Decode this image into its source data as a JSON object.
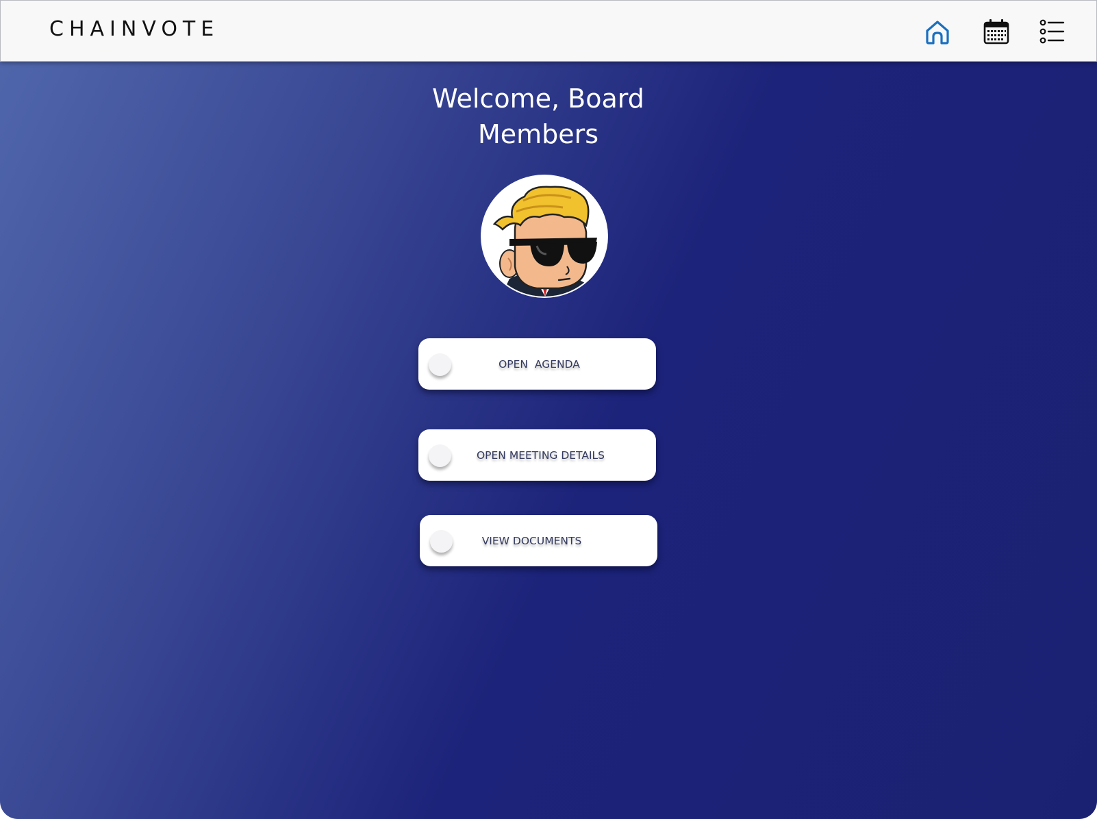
{
  "header": {
    "brand": "CHAINVOTE",
    "nav": [
      {
        "icon": "home-icon",
        "active": true,
        "color": "#1a6fc0"
      },
      {
        "icon": "calendar-icon",
        "active": false,
        "color": "#111111"
      },
      {
        "icon": "list-icon",
        "active": false,
        "color": "#111111"
      }
    ]
  },
  "main": {
    "welcome": "Welcome, Board Members",
    "avatar_icon": "sunglasses-mascot-avatar",
    "buttons": [
      {
        "label": "OPEN  AGENDA"
      },
      {
        "label": "OPEN MEETING DETAILS"
      },
      {
        "label": "VIEW DOCUMENTS"
      }
    ]
  },
  "colors": {
    "background_light": "#5168ad",
    "background_dark": "#1b2172",
    "header_bg": "#f8f8f8",
    "button_bg": "#ffffff",
    "button_text": "#33395e",
    "accent": "#1a6fc0"
  }
}
